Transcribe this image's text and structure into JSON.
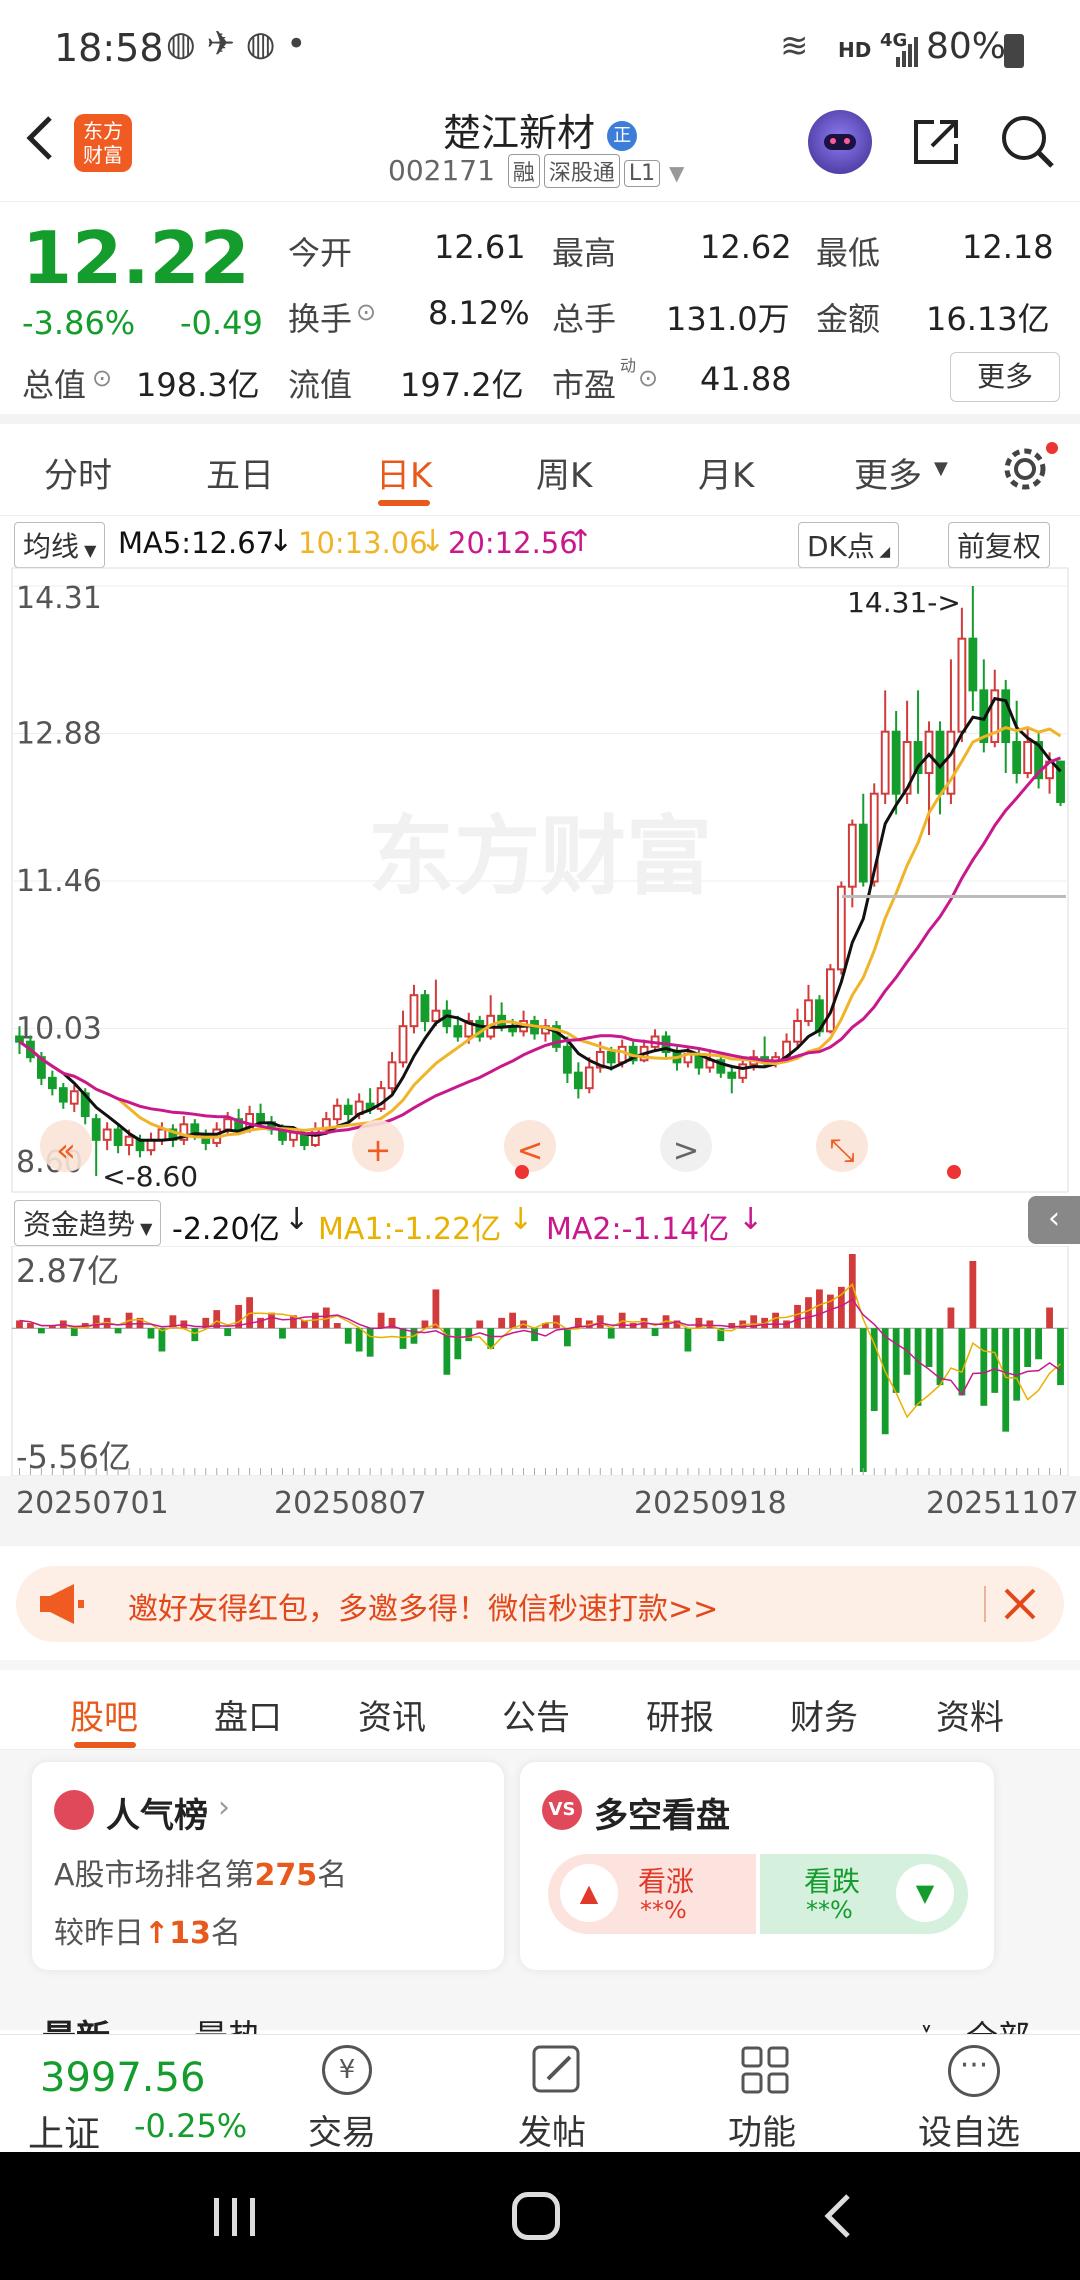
{
  "status": {
    "time": "18:58",
    "hd": "HD",
    "net": "4G",
    "battery": "80%"
  },
  "header": {
    "logo_line1": "东方",
    "logo_line2": "财富",
    "title": "楚江新材",
    "badge": "正",
    "code": "002171",
    "tags": [
      "融",
      "深股通",
      "L1"
    ]
  },
  "quote": {
    "price": "12.22",
    "change_pct": "-3.86%",
    "change": "-0.49",
    "open_label": "今开",
    "open": "12.61",
    "high_label": "最高",
    "high": "12.62",
    "low_label": "最低",
    "low": "12.18",
    "turnover_label": "换手",
    "turnover": "8.12%",
    "volume_label": "总手",
    "volume": "131.0万",
    "amount_label": "金额",
    "amount": "16.13亿",
    "mktcap_label": "总值",
    "mktcap": "198.3亿",
    "float_label": "流值",
    "float": "197.2亿",
    "pe_label": "市盈",
    "pe_sup": "动",
    "pe": "41.88",
    "more": "更多"
  },
  "chart_tabs": [
    "分时",
    "五日",
    "日K",
    "周K",
    "月K",
    "更多"
  ],
  "ma_bar": {
    "selector": "均线",
    "ma5": "MA5:12.67",
    "ma10": "10:13.06",
    "ma20": "20:12.56",
    "dk": "DK点",
    "adjust": "前复权"
  },
  "chart_data": {
    "type": "candlestick",
    "ylim": [
      8.6,
      14.31
    ],
    "y_ticks": [
      "14.31",
      "12.88",
      "11.46",
      "10.03",
      "8.60"
    ],
    "max_label": "14.31->",
    "min_label": "<-8.60",
    "watermark": "东方财富",
    "x_ticks": [
      "20250701",
      "20250807",
      "20250918",
      "20251107"
    ],
    "colors": {
      "up": "#d23b3b",
      "down": "#149c2c",
      "ma5": "#111111",
      "ma10": "#f0b429",
      "ma20": "#c8188c"
    },
    "candles": [
      [
        9.95,
        9.9,
        10.05,
        9.78
      ],
      [
        9.9,
        9.75,
        9.96,
        9.7
      ],
      [
        9.75,
        9.55,
        9.8,
        9.48
      ],
      [
        9.55,
        9.45,
        9.62,
        9.38
      ],
      [
        9.45,
        9.32,
        9.5,
        9.25
      ],
      [
        9.3,
        9.42,
        9.48,
        9.22
      ],
      [
        9.4,
        9.18,
        9.45,
        9.1
      ],
      [
        9.15,
        8.95,
        9.2,
        8.6
      ],
      [
        8.95,
        9.05,
        9.12,
        8.85
      ],
      [
        9.05,
        8.9,
        9.1,
        8.82
      ],
      [
        8.9,
        8.98,
        9.05,
        8.8
      ],
      [
        8.95,
        8.85,
        9.0,
        8.78
      ],
      [
        8.85,
        8.95,
        9.02,
        8.8
      ],
      [
        8.95,
        9.05,
        9.12,
        8.9
      ],
      [
        9.05,
        8.95,
        9.1,
        8.88
      ],
      [
        8.95,
        9.1,
        9.18,
        8.9
      ],
      [
        9.1,
        9.0,
        9.15,
        8.95
      ],
      [
        9.0,
        8.92,
        9.05,
        8.85
      ],
      [
        8.92,
        9.05,
        9.12,
        8.88
      ],
      [
        9.05,
        9.15,
        9.22,
        9.0
      ],
      [
        9.15,
        9.05,
        9.25,
        9.0
      ],
      [
        9.05,
        9.2,
        9.28,
        9.02
      ],
      [
        9.2,
        9.12,
        9.3,
        9.05
      ],
      [
        9.12,
        9.05,
        9.18,
        9.0
      ],
      [
        9.05,
        8.95,
        9.1,
        8.9
      ],
      [
        8.95,
        9.02,
        9.08,
        8.88
      ],
      [
        9.0,
        8.9,
        9.05,
        8.85
      ],
      [
        8.9,
        9.05,
        9.12,
        8.88
      ],
      [
        9.05,
        9.15,
        9.22,
        9.0
      ],
      [
        9.15,
        9.28,
        9.35,
        9.1
      ],
      [
        9.28,
        9.2,
        9.35,
        9.12
      ],
      [
        9.2,
        9.32,
        9.4,
        9.15
      ],
      [
        9.3,
        9.25,
        9.45,
        9.2
      ],
      [
        9.25,
        9.45,
        9.52,
        9.22
      ],
      [
        9.45,
        9.7,
        9.8,
        9.4
      ],
      [
        9.7,
        10.05,
        10.2,
        9.65
      ],
      [
        10.05,
        10.35,
        10.45,
        9.98
      ],
      [
        10.35,
        10.1,
        10.4,
        10.0
      ],
      [
        10.1,
        10.2,
        10.5,
        10.05
      ],
      [
        10.2,
        10.05,
        10.3,
        9.98
      ],
      [
        10.05,
        9.95,
        10.15,
        9.9
      ],
      [
        9.95,
        10.1,
        10.18,
        9.88
      ],
      [
        10.1,
        9.95,
        10.15,
        9.9
      ],
      [
        9.95,
        10.15,
        10.35,
        9.92
      ],
      [
        10.15,
        10.05,
        10.28,
        10.0
      ],
      [
        10.05,
        10.0,
        10.12,
        9.95
      ],
      [
        10.0,
        10.1,
        10.2,
        9.95
      ],
      [
        10.1,
        9.98,
        10.15,
        9.92
      ],
      [
        9.98,
        10.05,
        10.12,
        9.9
      ],
      [
        10.05,
        9.85,
        10.1,
        9.8
      ],
      [
        9.85,
        9.6,
        9.95,
        9.5
      ],
      [
        9.6,
        9.45,
        9.7,
        9.35
      ],
      [
        9.45,
        9.65,
        9.75,
        9.4
      ],
      [
        9.65,
        9.8,
        9.9,
        9.6
      ],
      [
        9.8,
        9.7,
        9.85,
        9.62
      ],
      [
        9.7,
        9.85,
        9.92,
        9.65
      ],
      [
        9.85,
        9.72,
        9.9,
        9.68
      ],
      [
        9.72,
        9.85,
        9.92,
        9.7
      ],
      [
        9.85,
        9.95,
        10.02,
        9.8
      ],
      [
        9.95,
        9.8,
        10.0,
        9.75
      ],
      [
        9.8,
        9.7,
        9.85,
        9.62
      ],
      [
        9.7,
        9.78,
        9.85,
        9.65
      ],
      [
        9.78,
        9.65,
        9.82,
        9.58
      ],
      [
        9.65,
        9.72,
        9.8,
        9.6
      ],
      [
        9.72,
        9.6,
        9.78,
        9.55
      ],
      [
        9.6,
        9.55,
        9.65,
        9.4
      ],
      [
        9.55,
        9.68,
        9.75,
        9.5
      ],
      [
        9.68,
        9.75,
        9.82,
        9.62
      ],
      [
        9.75,
        9.7,
        9.95,
        9.65
      ],
      [
        9.7,
        9.75,
        9.8,
        9.65
      ],
      [
        9.75,
        9.9,
        9.98,
        9.7
      ],
      [
        9.9,
        10.1,
        10.22,
        9.85
      ],
      [
        10.1,
        10.3,
        10.45,
        10.05
      ],
      [
        10.3,
        10.0,
        10.35,
        9.95
      ],
      [
        10.0,
        10.6,
        10.65,
        9.98
      ],
      [
        10.6,
        11.4,
        11.45,
        10.55
      ],
      [
        11.4,
        12.0,
        12.05,
        11.2
      ],
      [
        12.0,
        11.45,
        12.3,
        11.4
      ],
      [
        11.45,
        12.3,
        12.4,
        11.4
      ],
      [
        12.3,
        12.9,
        13.3,
        12.2
      ],
      [
        12.9,
        12.3,
        13.1,
        12.1
      ],
      [
        12.3,
        12.8,
        13.2,
        12.2
      ],
      [
        12.8,
        12.5,
        13.3,
        12.3
      ],
      [
        12.5,
        12.9,
        13.0,
        11.9
      ],
      [
        12.9,
        12.3,
        13.0,
        12.1
      ],
      [
        12.3,
        12.9,
        13.6,
        12.2
      ],
      [
        12.9,
        13.8,
        14.1,
        12.8
      ],
      [
        13.8,
        13.3,
        14.31,
        13.1
      ],
      [
        13.3,
        12.8,
        13.6,
        12.7
      ],
      [
        12.8,
        13.3,
        13.5,
        12.75
      ],
      [
        13.3,
        12.8,
        13.4,
        12.5
      ],
      [
        12.8,
        12.5,
        13.2,
        12.4
      ],
      [
        12.5,
        12.8,
        12.95,
        12.45
      ],
      [
        12.8,
        12.45,
        12.9,
        12.35
      ],
      [
        12.45,
        12.61,
        12.7,
        12.3
      ],
      [
        12.61,
        12.22,
        12.62,
        12.18
      ]
    ],
    "indicator": {
      "name": "资金趋势",
      "value": "-2.20亿",
      "ma1": "MA1:-1.22亿",
      "ma2": "MA2:-1.14亿",
      "ylim": [
        -5.56,
        2.87
      ],
      "y_ticks": [
        "2.87亿",
        "-5.56亿"
      ],
      "colors": {
        "pos": "#d23b3b",
        "neg": "#149c2c",
        "ma1": "#e8b000",
        "ma2": "#c8188c"
      },
      "bars": [
        0.3,
        0.2,
        -0.2,
        0.1,
        0.3,
        -0.3,
        0.2,
        0.5,
        0.4,
        -0.2,
        0.6,
        0.4,
        -0.4,
        -0.9,
        0.5,
        0.3,
        -0.5,
        0.4,
        0.7,
        -0.3,
        0.9,
        1.2,
        0.4,
        0.6,
        -0.4,
        0.5,
        0.3,
        0.6,
        0.8,
        0.2,
        -0.6,
        -0.9,
        -1.1,
        0.6,
        0.4,
        -0.8,
        -0.6,
        0.3,
        1.5,
        -1.8,
        -1.2,
        -0.5,
        0.3,
        -0.8,
        0.4,
        0.6,
        0.3,
        -0.5,
        0.2,
        0.5,
        -0.7,
        0.4,
        0.3,
        0.5,
        -0.4,
        0.6,
        0.2,
        0.4,
        -0.3,
        0.5,
        0.3,
        -0.9,
        0.4,
        0.3,
        -0.5,
        0.2,
        0.3,
        0.5,
        0.4,
        0.6,
        0.3,
        0.9,
        1.2,
        1.5,
        1.3,
        1.6,
        2.87,
        -5.56,
        -3.2,
        -4.1,
        -2.5,
        -1.8,
        -3.0,
        -1.5,
        -2.2,
        0.8,
        -2.6,
        2.6,
        -3.0,
        -2.5,
        -4.0,
        -2.8,
        -1.5,
        -1.2,
        0.8,
        -2.2
      ]
    }
  },
  "controls": {
    "left2": "«",
    "plus": "+",
    "left": "<",
    "right": ">",
    "expand": "⤡"
  },
  "banner": {
    "text": "邀好友得红包，多邀多得！微信秒速打款>>"
  },
  "sub_tabs": [
    "股吧",
    "盘口",
    "资讯",
    "公告",
    "研报",
    "财务",
    "资料"
  ],
  "popularity": {
    "title": "人气榜",
    "rank_prefix": "A股市场排名第",
    "rank": "275",
    "rank_suffix": "名",
    "change_prefix": "较昨日",
    "change": "13",
    "change_suffix": "名"
  },
  "sentiment": {
    "title": "多空看盘",
    "up_label": "看涨",
    "up_val": "**%",
    "down_label": "看跌",
    "down_val": "**%"
  },
  "peek": {
    "left": "最新",
    "mid": "最热",
    "right": "全部"
  },
  "bottom": {
    "index_value": "3997.56",
    "index_name": "上证",
    "index_change": "-0.25%",
    "trade": "交易",
    "post": "发帖",
    "func": "功能",
    "watch": "设自选"
  }
}
